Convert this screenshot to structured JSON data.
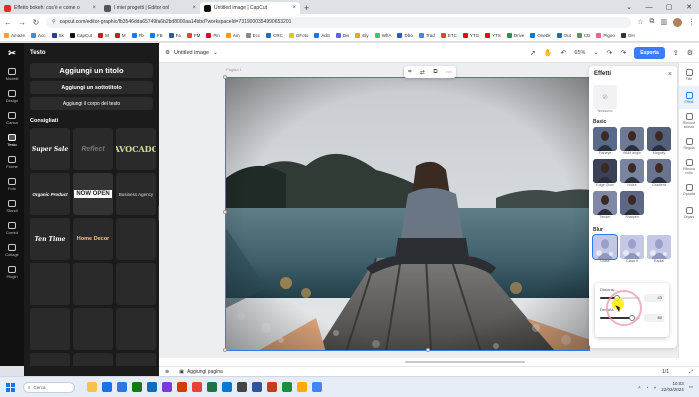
{
  "browser": {
    "tabs": [
      {
        "title": "Effetto bokeh: cos'è e come o",
        "color": "#d93025"
      },
      {
        "title": "I miei progetti | Editor onl",
        "color": "#555555"
      },
      {
        "title": "Untitled image | CapCut",
        "color": "#111111"
      }
    ],
    "url": "capcut.com/editor-graphic/fb3546dda65749fa6b2bd8000aa14bbd?workspaceId=7319000354990653201",
    "bookmarks": [
      "Amaze",
      "Acc",
      "Sk",
      "CapCut",
      "M",
      "M",
      "Fb",
      "FB",
      "Fa",
      "FM",
      "Pin",
      "Am",
      "Ecc",
      "CRC",
      "GFoto",
      "AdS",
      "Dis",
      "Ely",
      "WhA",
      "Dbo",
      "Trad",
      "ETC",
      "YTG",
      "YTS",
      "Drive",
      "OneDr",
      "Out",
      "CD",
      "Pigoo",
      "GH"
    ]
  },
  "rail": {
    "logo": "✂",
    "items": [
      {
        "label": "Modelli"
      },
      {
        "label": "Design"
      },
      {
        "label": "Carica"
      },
      {
        "label": "Testo"
      },
      {
        "label": "Forme"
      },
      {
        "label": "Foto"
      },
      {
        "label": "Sfondi"
      },
      {
        "label": "Cornici"
      },
      {
        "label": "Collage"
      },
      {
        "label": "Plugin"
      }
    ]
  },
  "text_panel": {
    "title": "Testo",
    "add_title": "Aggiungi un titolo",
    "add_subtitle": "Aggiungi un sottotitolo",
    "add_body": "Aggiungi il corpo del testo",
    "suggested": "Consigliati",
    "styles": [
      "Super Sale",
      "Reflect",
      "AVOCADO",
      "Organic Product",
      "NOW OPEN",
      "Business Agency",
      "Ten Time",
      "Home Decor"
    ]
  },
  "topbar": {
    "doc_name": "Untitled image",
    "zoom": "65%",
    "export": "Esporta"
  },
  "canvas": {
    "page_label": "Pagina 1"
  },
  "effects": {
    "title": "Effetti",
    "none_label": "Nessuno",
    "basic_title": "Basic",
    "basic": [
      "Fisheye",
      "Wide angle",
      "Magnify",
      "Edge Glow",
      "Noise",
      "Gradient",
      "Tender",
      "Sharpen"
    ],
    "blur_title": "Blur",
    "blur": [
      "Glass",
      "Glass II",
      "Radial"
    ],
    "sliders": {
      "first_label": "Dimensi...",
      "first_value": "43",
      "first_level": 0.43,
      "second_label": "Densità",
      "second_value": "80",
      "second_level": 0.8
    }
  },
  "side_rail": {
    "items": [
      "Filtri",
      "Effetti",
      "Rimuovi sfondo",
      "Regola",
      "Ritocca volto",
      "Opacità",
      "Organi"
    ]
  },
  "bottom": {
    "add_pages": "Aggiungi pagina",
    "page_number": "1/1"
  },
  "taskbar": {
    "search": "Cerca",
    "time": "10:03",
    "date": "22/02/2024",
    "apps": [
      "#f6c34a",
      "#1a73e8",
      "#2b78e4",
      "#107c10",
      "#0f6cbd",
      "#7a3bd6",
      "#d83b01",
      "#e94235",
      "#217346",
      "#0078d4",
      "#444444",
      "#2f5597",
      "#c43e1c",
      "#1f8c3b",
      "#f9ab00",
      "#4285f4"
    ]
  },
  "colors": {
    "accent": "#3c7bf6",
    "editor_dark": "#1b1b1b"
  }
}
